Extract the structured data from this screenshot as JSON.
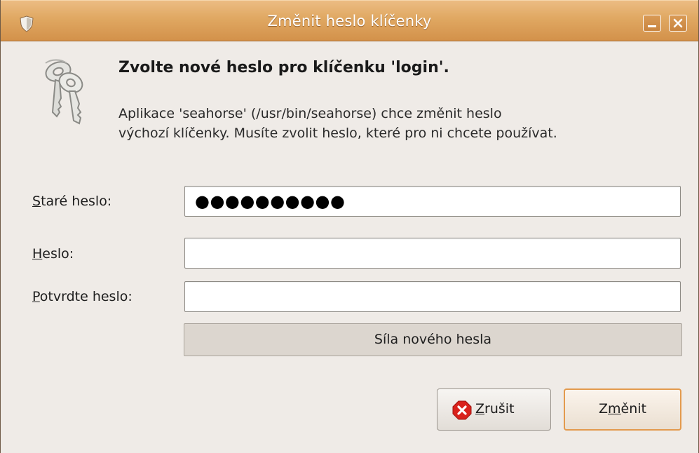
{
  "window": {
    "title": "Změnit heslo klíčenky"
  },
  "dialog": {
    "heading": "Zvolte nové heslo pro klíčenku 'login'.",
    "description_line1": "Aplikace 'seahorse' (/usr/bin/seahorse) chce změnit heslo",
    "description_line2": "výchozí klíčenky. Musíte zvolit heslo, které pro ni chcete používat."
  },
  "form": {
    "old_password": {
      "label_mnemonic": "S",
      "label_rest": "taré heslo:",
      "value": "●●●●●●●●●●"
    },
    "new_password": {
      "label_mnemonic": "H",
      "label_rest": "eslo:",
      "value": ""
    },
    "confirm_password": {
      "label_mnemonic": "P",
      "label_rest": "otvrdte heslo:",
      "value": ""
    },
    "strength": {
      "label": "Síla nového hesla",
      "fraction": 0
    }
  },
  "buttons": {
    "cancel": {
      "mnemonic": "Z",
      "rest": "rušit"
    },
    "change": {
      "before": "Z",
      "mnemonic": "m",
      "after": "ěnit"
    }
  },
  "icons": {
    "title": "shield-icon",
    "dialog": "keys-icon",
    "cancel": "cancel-x-icon"
  },
  "colors": {
    "titlebar": "#d99a55",
    "accent_border": "#e39a4d",
    "cancel_icon": "#d9221c"
  }
}
